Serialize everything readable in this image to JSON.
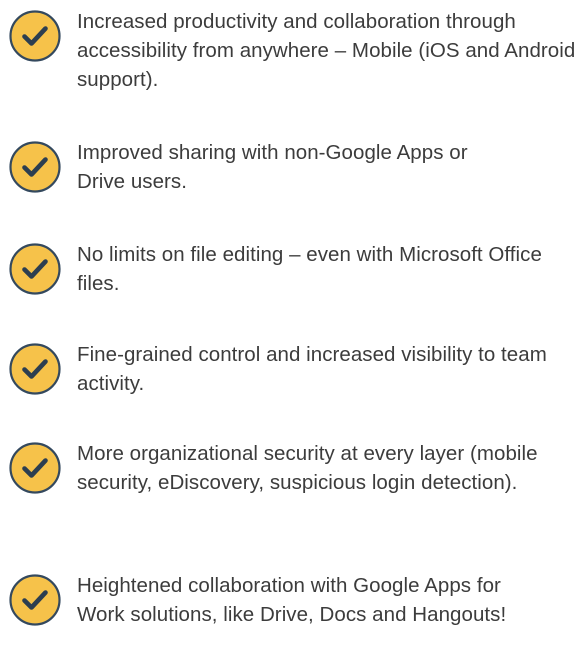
{
  "colors": {
    "badge_fill": "#f6c24a",
    "badge_border": "#34495e",
    "check_mark": "#2c3e50",
    "text": "#3c3c3c"
  },
  "icon": "check-circle-icon",
  "benefits": [
    {
      "text": "Increased productivity and collaboration through accessibility from anywhere – Mobile (iOS and Android support)."
    },
    {
      "text": "Improved sharing with non-Google Apps or Drive users."
    },
    {
      "text": "No limits on file editing – even with Microsoft Office files."
    },
    {
      "text": "Fine-grained control and increased visibility to team activity."
    },
    {
      "text": "More organizational security at every layer (mobile security, eDiscovery, suspicious login detection)."
    },
    {
      "text": "Heightened collaboration with Google Apps for Work solutions, like Drive, Docs and Hangouts!"
    }
  ]
}
